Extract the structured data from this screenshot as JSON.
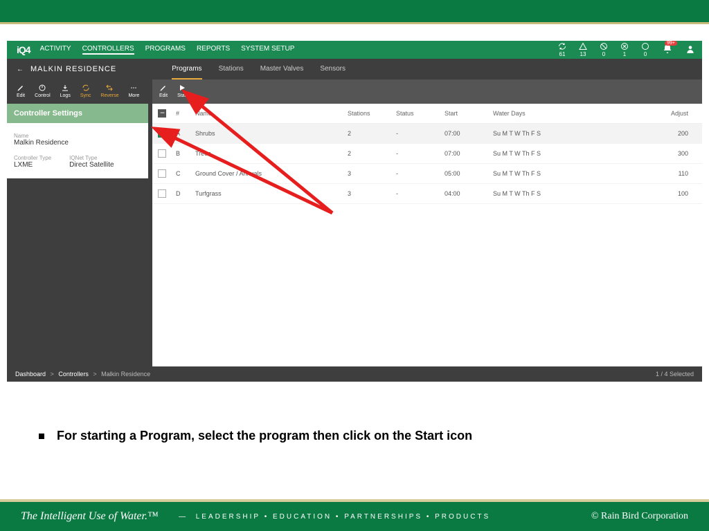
{
  "logo": "iQ4",
  "nav": {
    "items": [
      "ACTIVITY",
      "CONTROLLERS",
      "PROGRAMS",
      "REPORTS",
      "SYSTEM SETUP"
    ],
    "active": "CONTROLLERS"
  },
  "header_stats": [
    {
      "value": "61"
    },
    {
      "value": "13"
    },
    {
      "value": "0"
    },
    {
      "value": "1"
    },
    {
      "value": "0"
    }
  ],
  "bell_badge": "99+",
  "controller_bar": {
    "name": "MALKIN RESIDENCE"
  },
  "sub_tabs": {
    "items": [
      "Programs",
      "Stations",
      "Master Valves",
      "Sensors"
    ],
    "active": "Programs"
  },
  "side_tools": [
    "Edit",
    "Control",
    "Logs",
    "Sync",
    "Reverse",
    "More"
  ],
  "side_panel": {
    "title": "Controller Settings",
    "name_label": "Name",
    "name_value": "Malkin Residence",
    "ctype_label": "Controller Type",
    "ctype_value": "LXME",
    "iq_label": "IQNet Type",
    "iq_value": "Direct Satellite"
  },
  "main_tools": [
    "Edit",
    "Start"
  ],
  "columns": {
    "check": "",
    "id": "#",
    "name": "Name",
    "stations": "Stations",
    "status": "Status",
    "start": "Start",
    "waterdays": "Water Days",
    "adjust": "Adjust"
  },
  "rows": [
    {
      "checked": true,
      "id": "A",
      "name": "Shrubs",
      "stations": "2",
      "status": "-",
      "start": "07:00",
      "waterdays": "Su M T W Th F S",
      "adjust": "200"
    },
    {
      "checked": false,
      "id": "B",
      "name": "Trees",
      "stations": "2",
      "status": "-",
      "start": "07:00",
      "waterdays": "Su M T W Th F S",
      "adjust": "300"
    },
    {
      "checked": false,
      "id": "C",
      "name": "Ground Cover / Annuals",
      "stations": "3",
      "status": "-",
      "start": "05:00",
      "waterdays": "Su M T W Th F S",
      "adjust": "110"
    },
    {
      "checked": false,
      "id": "D",
      "name": "Turfgrass",
      "stations": "3",
      "status": "-",
      "start": "04:00",
      "waterdays": "Su M T W Th F S",
      "adjust": "100"
    }
  ],
  "breadcrumb": {
    "a": "Dashboard",
    "b": "Controllers",
    "c": "Malkin Residence",
    "selected": "1 / 4 Selected"
  },
  "instruction": "For starting a Program, select the program then click on the Start icon",
  "footer": {
    "tagline": "The Intelligent Use of Water.™",
    "links": "LEADERSHIP   •   EDUCATION   •   PARTNERSHIPS   •   PRODUCTS",
    "copyright": "© Rain Bird Corporation"
  }
}
